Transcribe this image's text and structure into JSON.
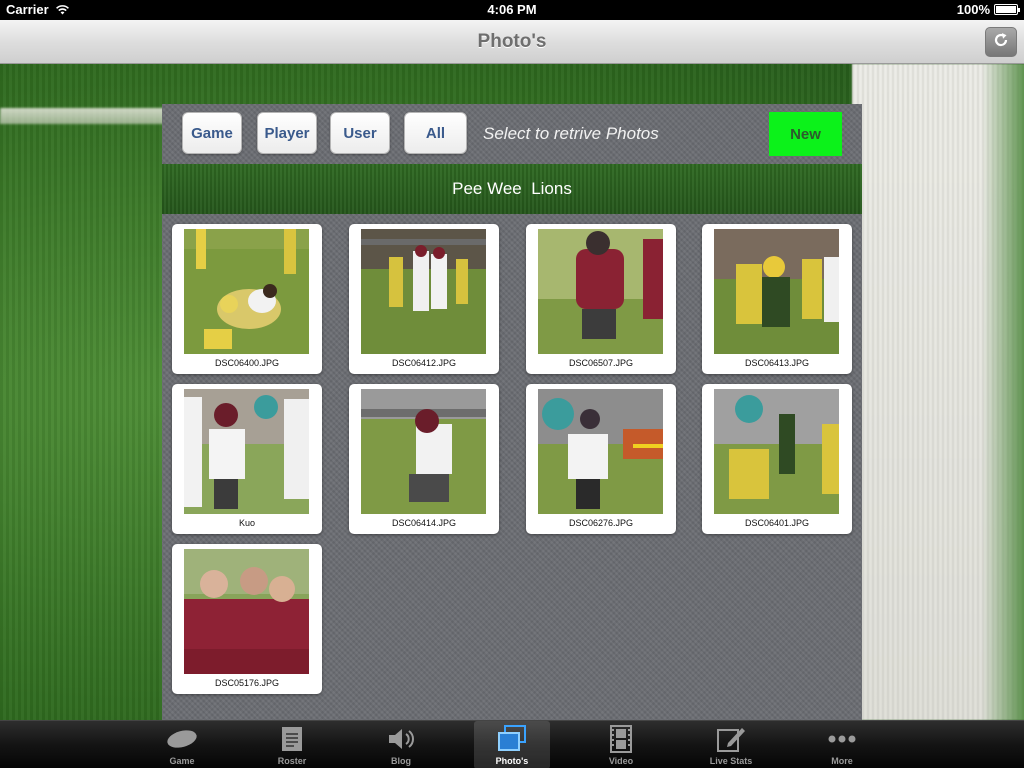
{
  "status_bar": {
    "carrier": "Carrier",
    "time": "4:06 PM",
    "battery": "100%"
  },
  "nav": {
    "title": "Photo's",
    "refresh_icon": "refresh-icon"
  },
  "toolbar": {
    "filters": [
      "Game",
      "Player",
      "User",
      "All"
    ],
    "hint": "Select to retrive Photos",
    "new_label": "New",
    "new_color": "#0cf21a"
  },
  "team": {
    "name": "Pee Wee  Lions"
  },
  "photos": [
    {
      "caption": "DSC06400.JPG"
    },
    {
      "caption": "DSC06412.JPG"
    },
    {
      "caption": "DSC06507.JPG"
    },
    {
      "caption": "DSC06413.JPG"
    },
    {
      "caption": "Kuo"
    },
    {
      "caption": "DSC06414.JPG"
    },
    {
      "caption": "DSC06276.JPG"
    },
    {
      "caption": "DSC06401.JPG"
    },
    {
      "caption": "DSC05176.JPG"
    }
  ],
  "tabs": [
    {
      "label": "Game",
      "icon": "football-icon",
      "active": false
    },
    {
      "label": "Roster",
      "icon": "document-icon",
      "active": false
    },
    {
      "label": "Blog",
      "icon": "speaker-icon",
      "active": false
    },
    {
      "label": "Photo's",
      "icon": "photos-icon",
      "active": true
    },
    {
      "label": "Video",
      "icon": "film-icon",
      "active": false
    },
    {
      "label": "Live Stats",
      "icon": "edit-icon",
      "active": false
    },
    {
      "label": "More",
      "icon": "more-icon",
      "active": false
    }
  ]
}
